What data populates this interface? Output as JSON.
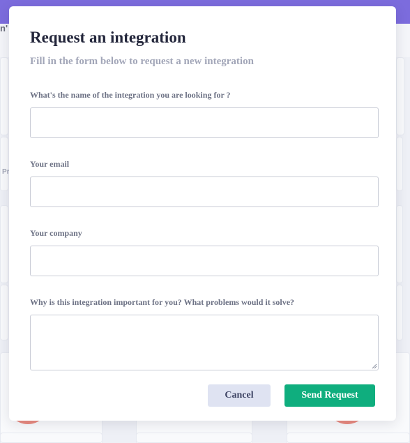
{
  "background": {
    "header_text": "n'",
    "side_label": "Pr"
  },
  "modal": {
    "title": "Request an integration",
    "subtitle": "Fill in the form below to request a new integration",
    "fields": [
      {
        "label": "What's the name of the integration you are looking for ?",
        "value": "",
        "placeholder": ""
      },
      {
        "label": "Your email",
        "value": "",
        "placeholder": ""
      },
      {
        "label": "Your company",
        "value": "",
        "placeholder": ""
      },
      {
        "label": "Why is this integration important for you? What problems would it solve?",
        "value": "",
        "placeholder": ""
      }
    ],
    "cancel_label": "Cancel",
    "send_label": "Send Request"
  },
  "colors": {
    "top_bar": "#3f25cf",
    "primary_button": "#0fae7e",
    "secondary_button": "#dfe3f2",
    "accent_logo": "#e8533f"
  }
}
